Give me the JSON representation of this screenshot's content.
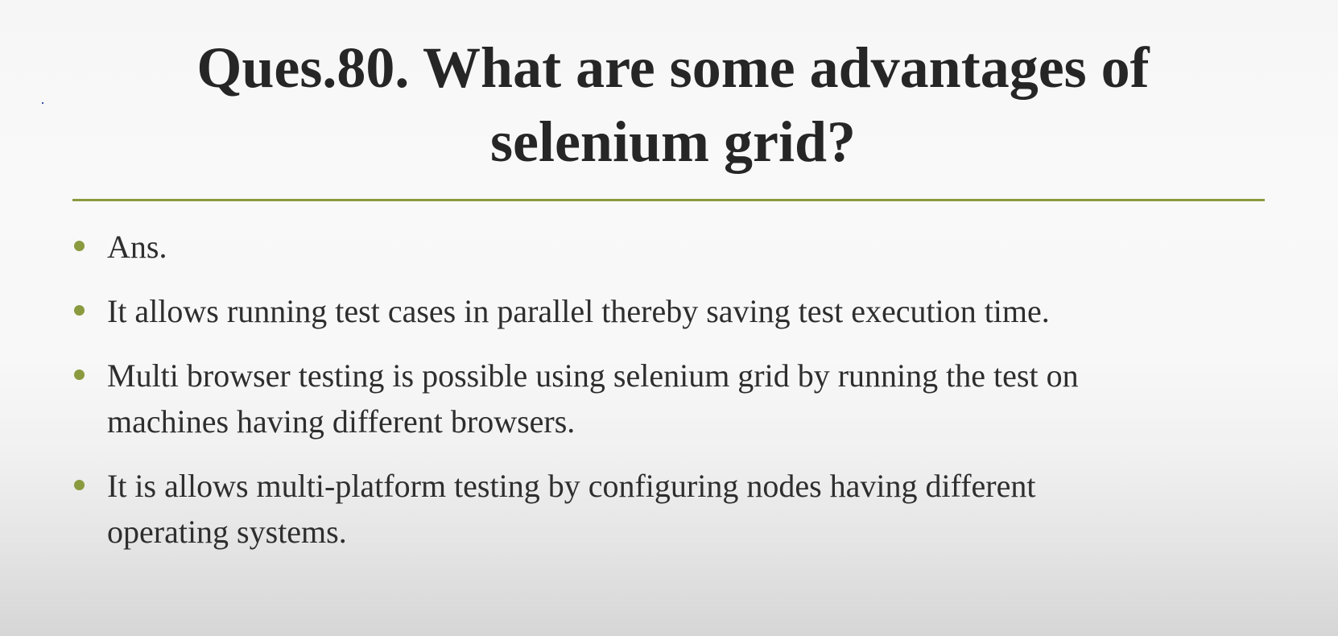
{
  "slide": {
    "title_line_1": "Ques.80. What are some advantages of",
    "title_line_2": "selenium grid?",
    "bullets": [
      {
        "lines": [
          "Ans."
        ]
      },
      {
        "lines": [
          "It allows running test cases in parallel thereby saving test execution time."
        ]
      },
      {
        "lines": [
          "Multi browser testing is possible using selenium grid by running the test on",
          "machines having different browsers."
        ]
      },
      {
        "lines": [
          "It is allows multi-platform testing by configuring nodes having different",
          "operating systems."
        ]
      }
    ]
  },
  "colors": {
    "accent": "#8a9a3f",
    "text": "#2e2e2e",
    "title": "#262626"
  }
}
